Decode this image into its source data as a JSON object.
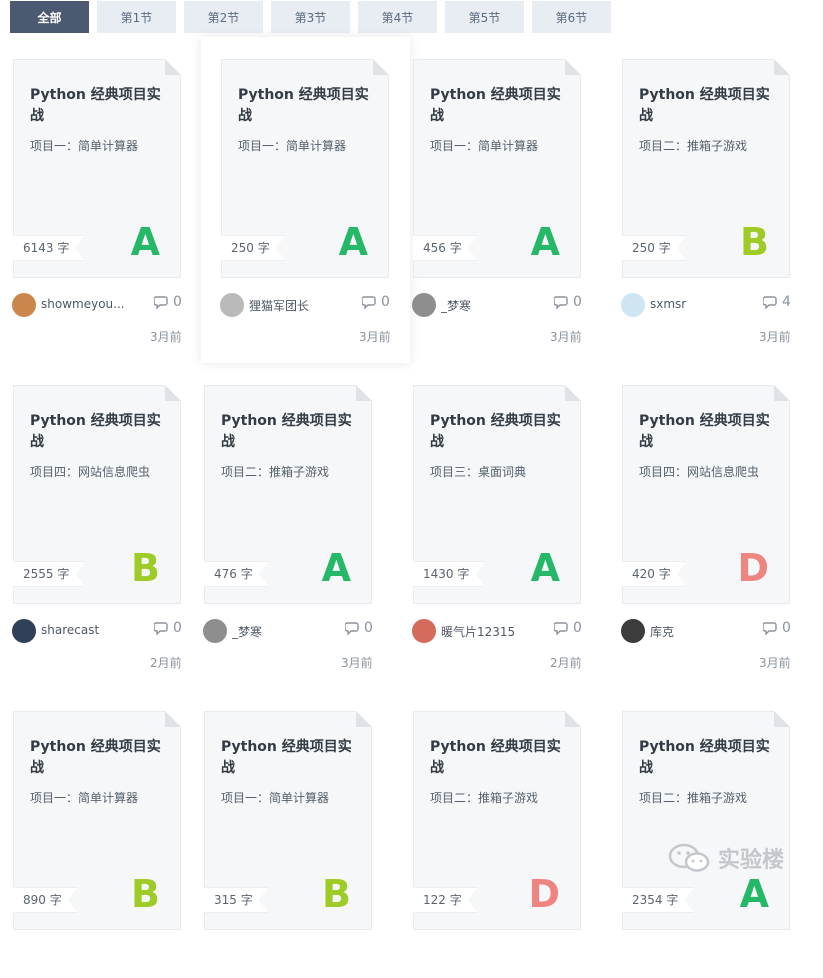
{
  "tabs": [
    "全部",
    "第1节",
    "第2节",
    "第3节",
    "第4节",
    "第5节",
    "第6节"
  ],
  "grade_colors": {
    "A": "#25b869",
    "B": "#9ecb25",
    "D": "#ef8580"
  },
  "cards": [
    {
      "title": "Python 经典项目实战",
      "subtitle": "项目一：简单计算器",
      "count": "6143 字",
      "grade": "A",
      "author": "showmeyou...",
      "comments": "0",
      "time": "3月前",
      "avatar_color": "#c9874b"
    },
    {
      "title": "Python 经典项目实战",
      "subtitle": "项目一：简单计算器",
      "count": "250 字",
      "grade": "A",
      "author": "狸猫军团长",
      "comments": "0",
      "time": "3月前",
      "avatar_color": "#b9b9b9"
    },
    {
      "title": "Python 经典项目实战",
      "subtitle": "项目一：简单计算器",
      "count": "456 字",
      "grade": "A",
      "author": "_梦寒",
      "comments": "0",
      "time": "3月前",
      "avatar_color": "#8e8e8e"
    },
    {
      "title": "Python 经典项目实战",
      "subtitle": "项目二：推箱子游戏",
      "count": "250 字",
      "grade": "B",
      "author": "sxmsr",
      "comments": "4",
      "time": "3月前",
      "avatar_color": "#cde6f2"
    },
    {
      "title": "Python 经典项目实战",
      "subtitle": "项目四：网站信息爬虫",
      "count": "2555 字",
      "grade": "B",
      "author": "sharecast",
      "comments": "0",
      "time": "2月前",
      "avatar_color": "#2f4058"
    },
    {
      "title": "Python 经典项目实战",
      "subtitle": "项目二：推箱子游戏",
      "count": "476 字",
      "grade": "A",
      "author": "_梦寒",
      "comments": "0",
      "time": "3月前",
      "avatar_color": "#8e8e8e"
    },
    {
      "title": "Python 经典项目实战",
      "subtitle": "项目三：桌面词典",
      "count": "1430 字",
      "grade": "A",
      "author": "暖气片12315",
      "comments": "0",
      "time": "2月前",
      "avatar_color": "#d46b5b"
    },
    {
      "title": "Python 经典项目实战",
      "subtitle": "项目四：网站信息爬虫",
      "count": "420 字",
      "grade": "D",
      "author": "库克",
      "comments": "0",
      "time": "3月前",
      "avatar_color": "#3c3c3c"
    },
    {
      "title": "Python 经典项目实战",
      "subtitle": "项目一：简单计算器",
      "count": "890 字",
      "grade": "B",
      "author": "",
      "comments": "",
      "time": "",
      "avatar_color": ""
    },
    {
      "title": "Python 经典项目实战",
      "subtitle": "项目一：简单计算器",
      "count": "315 字",
      "grade": "B",
      "author": "",
      "comments": "",
      "time": "",
      "avatar_color": ""
    },
    {
      "title": "Python 经典项目实战",
      "subtitle": "项目二：推箱子游戏",
      "count": "122 字",
      "grade": "D",
      "author": "",
      "comments": "",
      "time": "",
      "avatar_color": ""
    },
    {
      "title": "Python 经典项目实战",
      "subtitle": "项目二：推箱子游戏",
      "count": "2354 字",
      "grade": "A",
      "author": "",
      "comments": "",
      "time": "",
      "avatar_color": ""
    }
  ],
  "watermark": "实验楼"
}
